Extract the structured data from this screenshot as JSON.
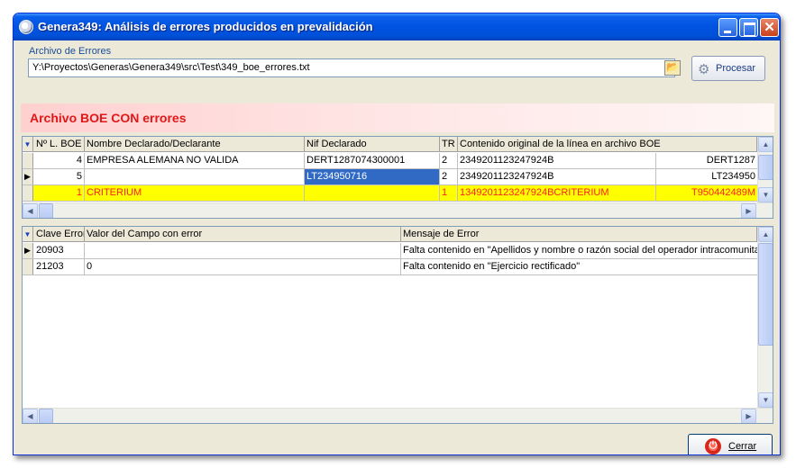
{
  "window": {
    "title": "Genera349: Análisis de errores producidos en prevalidación"
  },
  "file": {
    "label": "Archivo de Errores",
    "path": "Y:\\Proyectos\\Generas\\Genera349\\src\\Test\\349_boe_errores.txt",
    "process_button": "Procesar"
  },
  "banner": {
    "text": "Archivo BOE CON errores",
    "color": "#e01818"
  },
  "grid1": {
    "columns": [
      "Nº L. BOE",
      "Nombre Declarado/Declarante",
      "Nif Declarado",
      "TR",
      "Contenido original de la línea en archivo BOE"
    ],
    "rows": [
      {
        "line": "4",
        "name": "EMPRESA ALEMANA NO VALIDA",
        "nif": "DERT1287074300001",
        "tr": "2",
        "content": "2349201123247924B",
        "content_tail": "DERT1287"
      },
      {
        "line": "5",
        "name": "",
        "nif": "LT234950716",
        "tr": "2",
        "content": "2349201123247924B",
        "content_tail": "LT234950"
      },
      {
        "line": "1",
        "name": "CRITERIUM",
        "nif": "",
        "tr": "1",
        "content": "1349201123247924BCRITERIUM",
        "content_tail": "T950442489M"
      }
    ],
    "highlight_color": "#ffff00"
  },
  "grid2": {
    "columns": [
      "Clave Error",
      "Valor del Campo con error",
      "Mensaje de Error"
    ],
    "rows": [
      {
        "code": "20903",
        "value": "",
        "message": "Falta contenido en \"Apellidos y nombre o razón social del operador intracomunitario"
      },
      {
        "code": "21203",
        "value": "0",
        "message": "Falta contenido en \"Ejercicio rectificado\""
      }
    ]
  },
  "close_button": "Cerrar"
}
